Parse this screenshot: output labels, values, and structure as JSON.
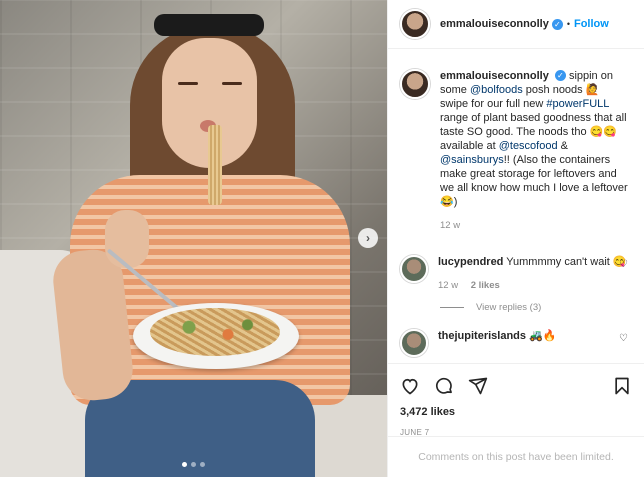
{
  "post": {
    "author": "emmalouiseconnolly",
    "follow_label": "Follow",
    "separator": "•",
    "caption": {
      "username": "emmalouiseconnolly",
      "t1": "sippin on some ",
      "m1": "@bolfoods",
      "t2": " posh noods 🙋 swipe for our full new ",
      "h1": "#powerFULL",
      "t3": " range of plant based goodness that all taste SO good. The noods tho 😋😋 available at ",
      "m2": "@tescofood",
      "t4": " & ",
      "m3": "@sainsburys",
      "t5": "!! (Also the containers make great storage for leftovers and we all know how much I love a leftover 😂)",
      "time": "12 w"
    },
    "comments": [
      {
        "username": "lucypendred",
        "text": " Yummmmy can't wait 😋",
        "time": "12 w",
        "likes": "2 likes",
        "view_replies": "View replies (3)"
      },
      {
        "username": "thejupiterislands",
        "text": " 🚜🔥"
      }
    ],
    "likes_count": "3,472 likes",
    "date": "JUNE 7",
    "comments_limited": "Comments on this post have been limited."
  },
  "icons": {
    "verified": "verified-badge-icon",
    "like": "heart-icon",
    "comment": "comment-icon",
    "share": "share-icon",
    "save": "bookmark-icon",
    "next": "chevron-right-icon"
  },
  "colors": {
    "link": "#00376b",
    "follow": "#0095f6",
    "verified": "#3897f0",
    "muted": "#8e8e8e"
  },
  "carousel": {
    "total": 3,
    "active": 1
  }
}
